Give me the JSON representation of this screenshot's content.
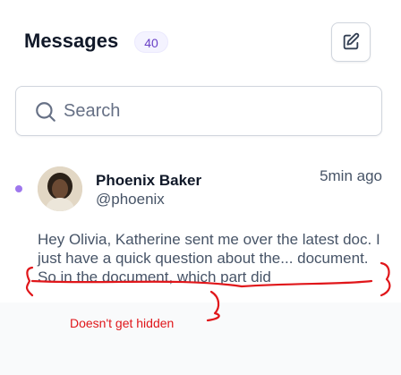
{
  "header": {
    "title": "Messages",
    "count": "40",
    "compose_icon": "edit-square-icon"
  },
  "search": {
    "placeholder": "Search",
    "value": "",
    "icon": "search-icon"
  },
  "message": {
    "unread": true,
    "unread_color": "#9e77ed",
    "avatar": "avatar",
    "sender_name": "Phoenix Baker",
    "sender_handle": "@phoenix",
    "timestamp": "5min ago",
    "preview": "Hey Olivia, Katherine sent me over the latest doc. I just have a quick question about the... document. So in the document, which part did"
  },
  "annotation": {
    "note": "Doesn't get hidden",
    "color": "#e0161a"
  },
  "colors": {
    "accent": "#6941c6",
    "badge_bg": "#f4f3ff",
    "text_primary": "#101828",
    "text_secondary": "#475467"
  }
}
